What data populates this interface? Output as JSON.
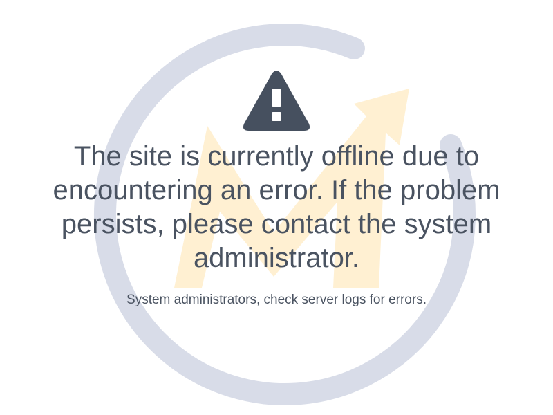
{
  "icons": {
    "background": "maintenance-logo-icon",
    "alert": "warning-icon"
  },
  "colors": {
    "text": "#4a5361",
    "icon": "#46505f",
    "logo_ring": "#d8dce8",
    "logo_arrow": "#fff0d2"
  },
  "error": {
    "message": "The site is currently offline due to encountering an error. If the problem persists, please contact the system administrator.",
    "hint": "System administrators, check server logs for errors."
  }
}
